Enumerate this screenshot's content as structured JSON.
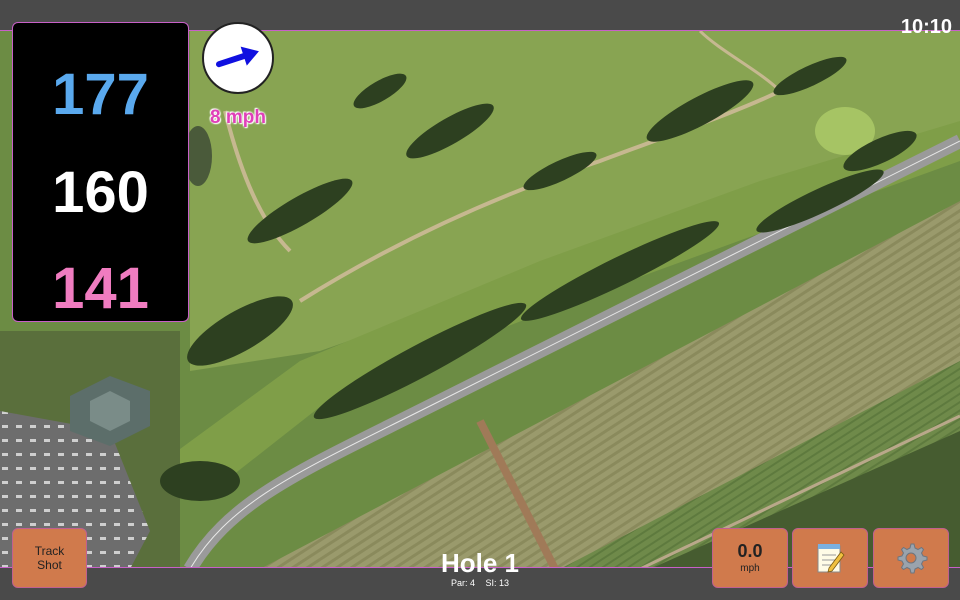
{
  "status": {
    "time": "10:10"
  },
  "distances": {
    "back": "177",
    "middle": "160",
    "front": "141"
  },
  "wind": {
    "speed": "8 mph",
    "icon": "wind-arrow-icon"
  },
  "track_button": {
    "line1": "Track",
    "line2": "Shot"
  },
  "hole": {
    "title": "Hole 1",
    "par": "Par: 4",
    "si": "SI: 13"
  },
  "speed_button": {
    "value": "0.0",
    "unit": "mph"
  },
  "notes_button": {
    "icon": "notepad-icon"
  },
  "settings_button": {
    "icon": "gear-icon"
  },
  "colors": {
    "back": "#5aa9ee",
    "middle": "#ffffff",
    "front": "#f07cc0",
    "button": "#d07a4c",
    "accent": "#c860c8"
  }
}
